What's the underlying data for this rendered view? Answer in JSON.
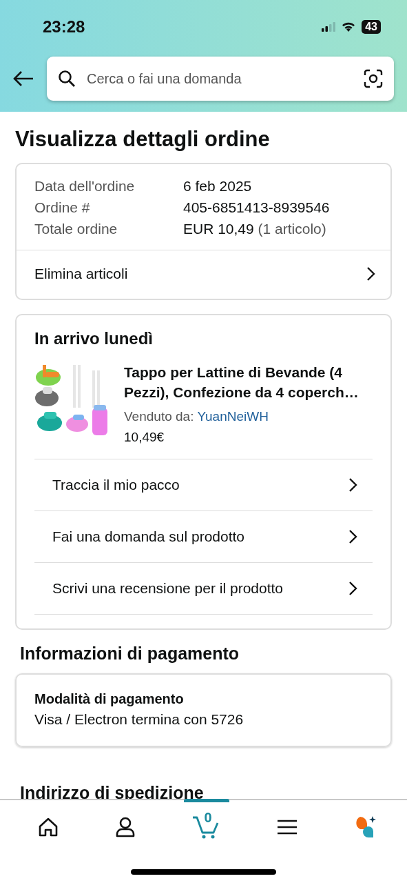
{
  "status_bar": {
    "time": "23:28",
    "battery": "43"
  },
  "search": {
    "placeholder": "Cerca o fai una domanda"
  },
  "title": "Visualizza dettagli ordine",
  "summary": {
    "rows": [
      {
        "label": "Data dell'ordine",
        "value": "6 feb 2025"
      },
      {
        "label": "Ordine #",
        "value": "405-6851413-8939546"
      },
      {
        "label": "Totale ordine",
        "value": "EUR 10,49",
        "note": "(1 articolo)"
      }
    ],
    "action": "Elimina articoli"
  },
  "shipment": {
    "heading": "In arrivo lunedì",
    "product": {
      "kind": "picture",
      "title": "Tappo per Lattine di Bevande (4 Pezzi), Confezione da 4 coperch…",
      "seller_label": "Venduto da:",
      "seller": "YuanNeiWH",
      "price": "10,49€"
    },
    "actions": [
      "Traccia il mio pacco",
      "Fai una domanda sul prodotto",
      "Scrivi una recensione per il prodotto"
    ]
  },
  "payment": {
    "heading": "Informazioni di pagamento",
    "method_label": "Modalità di pagamento",
    "method": "Visa / Electron  termina con 5726"
  },
  "next_heading": "Indirizzo di spedizione",
  "nav": [
    {
      "kind": "home",
      "selected": false
    },
    {
      "kind": "account",
      "selected": false
    },
    {
      "kind": "cart",
      "selected": true,
      "count": "0"
    },
    {
      "kind": "menu",
      "selected": false
    },
    {
      "kind": "assistant",
      "selected": false
    }
  ]
}
